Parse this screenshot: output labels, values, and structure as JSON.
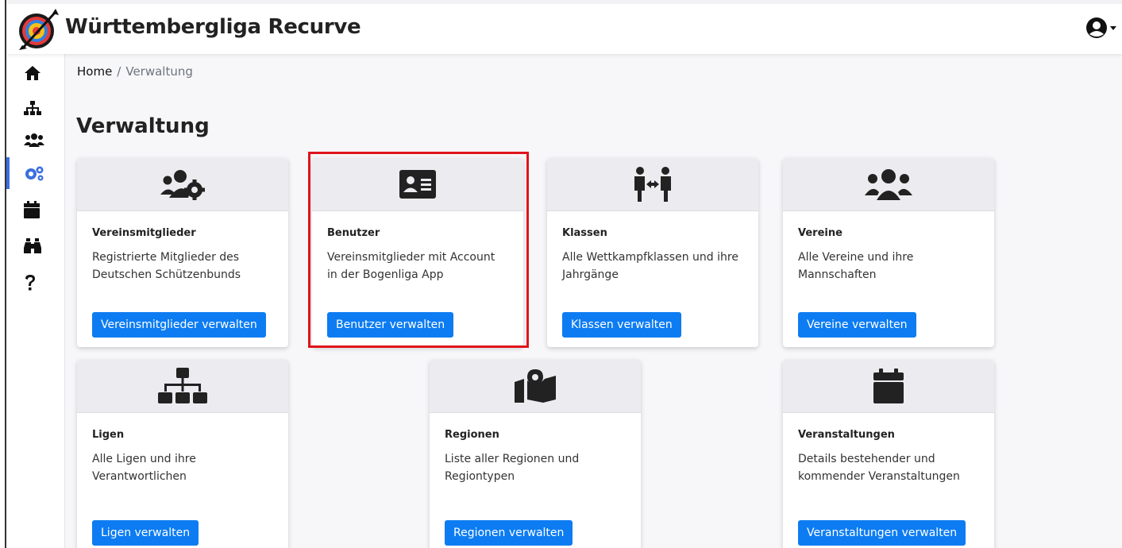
{
  "app": {
    "title": "Württembergliga Recurve"
  },
  "breadcrumb": {
    "home": "Home",
    "separator": "/",
    "current": "Verwaltung"
  },
  "page": {
    "title": "Verwaltung"
  },
  "sidebar": {
    "items": [
      {
        "icon": "home-icon"
      },
      {
        "icon": "sitemap-icon"
      },
      {
        "icon": "users-icon"
      },
      {
        "icon": "users-cog-icon",
        "active": true
      },
      {
        "icon": "calendar-icon"
      },
      {
        "icon": "binoculars-icon"
      },
      {
        "icon": "question-icon"
      }
    ]
  },
  "cards": [
    {
      "icon": "users-cog-icon",
      "title": "Vereinsmitglieder",
      "text": "Registrierte Mitglieder des Deutschen Schützenbunds",
      "button": "Vereinsmitglieder verwalten"
    },
    {
      "icon": "id-card-icon",
      "title": "Benutzer",
      "text": "Vereinsmitglieder mit Account in der Bogenliga App",
      "button": "Benutzer verwalten"
    },
    {
      "icon": "people-arrows-icon",
      "title": "Klassen",
      "text": "Alle Wettkampfklassen und ihre Jahrgänge",
      "button": "Klassen verwalten"
    },
    {
      "icon": "users-icon",
      "title": "Vereine",
      "text": "Alle Vereine und ihre Mannschaften",
      "button": "Vereine verwalten"
    },
    {
      "icon": "sitemap-icon",
      "title": "Ligen",
      "text": "Alle Ligen und ihre Verantwortlichen",
      "button": "Ligen verwalten"
    },
    {
      "icon": "map-marked-icon",
      "title": "Regionen",
      "text": "Liste aller Regionen und Regiontypen",
      "button": "Regionen verwalten"
    },
    {
      "icon": "calendar-icon",
      "title": "Veranstaltungen",
      "text": "Details bestehender und kommender Veranstaltungen",
      "button": "Veranstaltungen verwalten"
    }
  ],
  "colors": {
    "primary": "#0d7cf2",
    "highlight": "#e0141b",
    "active_nav": "#3b6fe0"
  }
}
